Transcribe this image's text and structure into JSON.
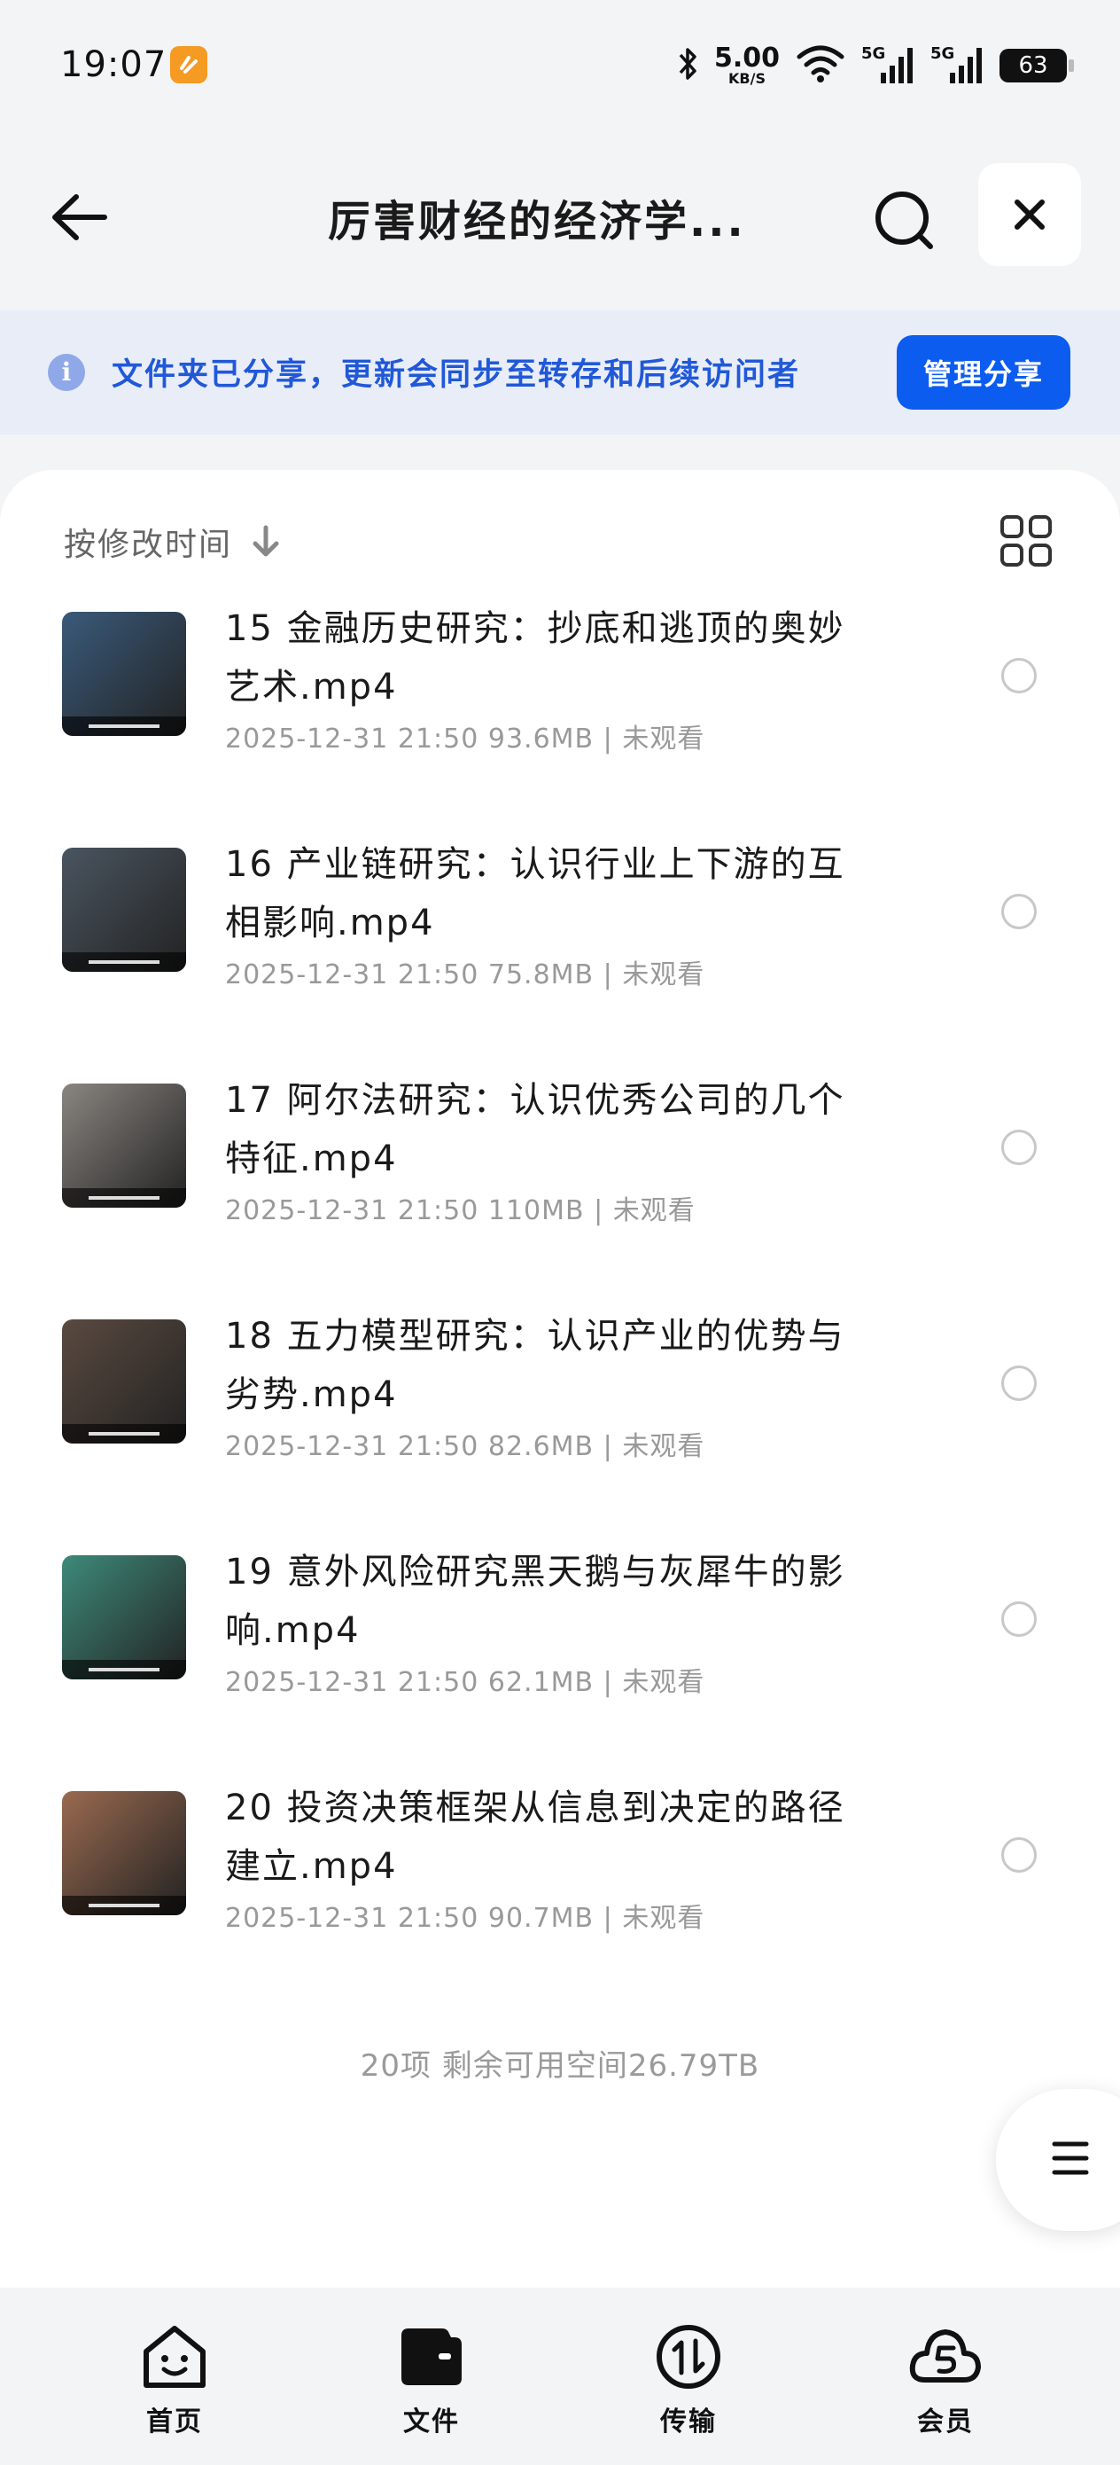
{
  "status_bar": {
    "time": "19:07",
    "network_speed": "5.00",
    "network_unit": "KB/S",
    "signal_1": "5G",
    "signal_2": "5G",
    "battery": "63"
  },
  "header": {
    "title": "厉害财经的经济学..."
  },
  "banner": {
    "text": "文件夹已分享，更新会同步至转存和后续访问者",
    "manage_button": "管理分享"
  },
  "sort": {
    "label": "按修改时间"
  },
  "files": [
    {
      "name": "15 金融历史研究：抄底和逃顶的奥妙艺术.mp4",
      "meta": "2025-12-31 21:50  93.6MB | 未观看",
      "thumb_color": "#3a5a7a"
    },
    {
      "name": "16 产业链研究：认识行业上下游的互相影响.mp4",
      "meta": "2025-12-31 21:50  75.8MB | 未观看",
      "thumb_color": "#4a5560"
    },
    {
      "name": "17 阿尔法研究：认识优秀公司的几个特征.mp4",
      "meta": "2025-12-31 21:50  110MB | 未观看",
      "thumb_color": "#8a8580"
    },
    {
      "name": "18 五力模型研究：认识产业的优势与劣势.mp4",
      "meta": "2025-12-31 21:50  82.6MB | 未观看",
      "thumb_color": "#5a4a40"
    },
    {
      "name": "19 意外风险研究黑天鹅与灰犀牛的影响.mp4",
      "meta": "2025-12-31 21:50  62.1MB | 未观看",
      "thumb_color": "#3d8a7a"
    },
    {
      "name": "20 投资决策框架从信息到决定的路径建立.mp4",
      "meta": "2025-12-31 21:50  90.7MB | 未观看",
      "thumb_color": "#9a6a50"
    }
  ],
  "summary": "20项 剩余可用空间26.79TB",
  "nav": {
    "home": "首页",
    "files": "文件",
    "transfer": "传输",
    "vip": "会员"
  },
  "colors": {
    "accent": "#0c5cf0",
    "banner_bg": "#e8edf8",
    "banner_text": "#2058d8"
  }
}
